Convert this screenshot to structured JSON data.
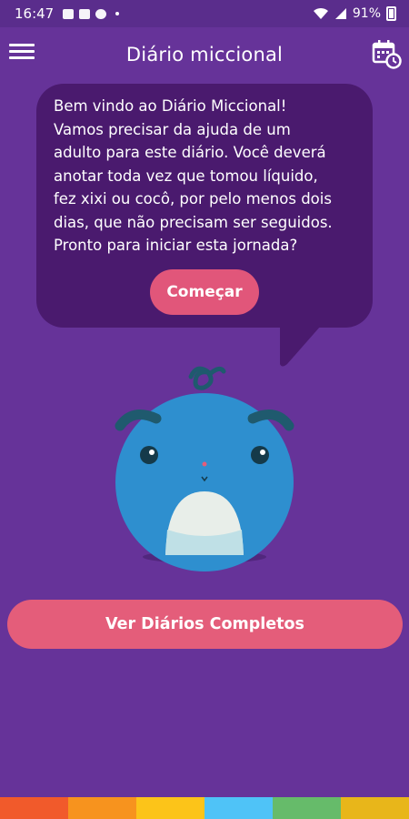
{
  "status_bar": {
    "time": "16:47",
    "battery": "91%"
  },
  "app_bar": {
    "title": "Diário miccional",
    "menu_icon": "hamburger-menu-icon",
    "calendar_icon": "calendar-clock-icon"
  },
  "welcome": {
    "lines": [
      "Bem vindo ao Diário Miccional!",
      "Vamos precisar da ajuda de um",
      "adulto para este diário. Você deverá",
      "anotar toda vez que tomou líquido,",
      "fez xixi ou cocô, por pelo menos dois",
      "dias, que não precisam ser seguidos.",
      "Pronto para iniciar esta jornada?"
    ],
    "start_button": "Começar"
  },
  "actions": {
    "view_diaries_button": "Ver Diários Completos"
  },
  "colors": {
    "background": "#663399",
    "bubble": "#4a1a6e",
    "accent_button": "#e45d7a",
    "stripe": [
      "#f15a2b",
      "#f7931e",
      "#fcc419",
      "#4fc3f7",
      "#66bb6a",
      "#f9c21c"
    ]
  }
}
